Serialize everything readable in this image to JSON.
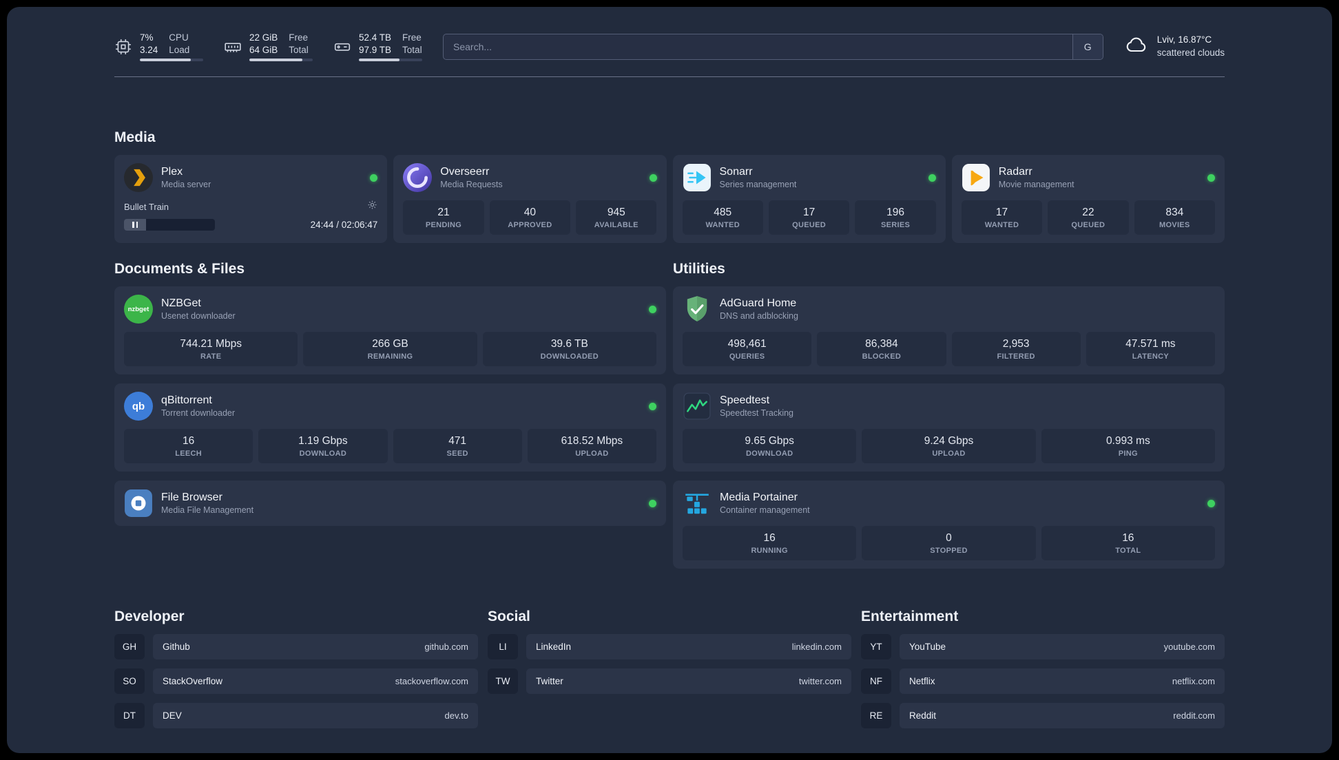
{
  "topbar": {
    "cpu": {
      "icon": "cpu-chip-icon",
      "percent": "7%",
      "load": "3.24",
      "label_top": "CPU",
      "label_bottom": "Load",
      "bar_percent": 80
    },
    "ram": {
      "icon": "ram-icon",
      "free": "22 GiB",
      "total": "64 GiB",
      "label_top": "Free",
      "label_bottom": "Total",
      "bar_percent": 84
    },
    "disk": {
      "icon": "hard-disk-icon",
      "free": "52.4 TB",
      "total": "97.9 TB",
      "label_top": "Free",
      "label_bottom": "Total",
      "bar_percent": 64
    },
    "search": {
      "placeholder": "Search...",
      "engine_button": "G"
    },
    "weather": {
      "icon": "cloud-icon",
      "location": "Lviv, 16.87°C",
      "condition": "scattered clouds"
    }
  },
  "icons": {
    "nzbget_label": "nzbget",
    "qbittorrent_label": "qb"
  },
  "sections": {
    "media": {
      "heading": "Media",
      "plex": {
        "icon": "plex-icon",
        "title": "Plex",
        "subtitle": "Media server",
        "now_playing": "Bullet Train",
        "time": "24:44 / 02:06:47"
      },
      "overseerr": {
        "icon": "overseerr-icon",
        "title": "Overseerr",
        "subtitle": "Media Requests",
        "stats": [
          {
            "value": "21",
            "label": "PENDING"
          },
          {
            "value": "40",
            "label": "APPROVED"
          },
          {
            "value": "945",
            "label": "AVAILABLE"
          }
        ]
      },
      "sonarr": {
        "icon": "sonarr-icon",
        "title": "Sonarr",
        "subtitle": "Series management",
        "stats": [
          {
            "value": "485",
            "label": "WANTED"
          },
          {
            "value": "17",
            "label": "QUEUED"
          },
          {
            "value": "196",
            "label": "SERIES"
          }
        ]
      },
      "radarr": {
        "icon": "radarr-icon",
        "title": "Radarr",
        "subtitle": "Movie management",
        "stats": [
          {
            "value": "17",
            "label": "WANTED"
          },
          {
            "value": "22",
            "label": "QUEUED"
          },
          {
            "value": "834",
            "label": "MOVIES"
          }
        ]
      }
    },
    "documents": {
      "heading": "Documents & Files",
      "nzbget": {
        "icon": "nzbget-icon",
        "title": "NZBGet",
        "subtitle": "Usenet downloader",
        "stats": [
          {
            "value": "744.21 Mbps",
            "label": "RATE"
          },
          {
            "value": "266 GB",
            "label": "REMAINING"
          },
          {
            "value": "39.6 TB",
            "label": "DOWNLOADED"
          }
        ]
      },
      "qbittorrent": {
        "icon": "qbittorrent-icon",
        "title": "qBittorrent",
        "subtitle": "Torrent downloader",
        "stats": [
          {
            "value": "16",
            "label": "LEECH"
          },
          {
            "value": "1.19 Gbps",
            "label": "DOWNLOAD"
          },
          {
            "value": "471",
            "label": "SEED"
          },
          {
            "value": "618.52 Mbps",
            "label": "UPLOAD"
          }
        ]
      },
      "filebrowser": {
        "icon": "filebrowser-icon",
        "title": "File Browser",
        "subtitle": "Media File Management"
      }
    },
    "utilities": {
      "heading": "Utilities",
      "adguard": {
        "icon": "adguard-shield-icon",
        "title": "AdGuard Home",
        "subtitle": "DNS and adblocking",
        "stats": [
          {
            "value": "498,461",
            "label": "QUERIES"
          },
          {
            "value": "86,384",
            "label": "BLOCKED"
          },
          {
            "value": "2,953",
            "label": "FILTERED"
          },
          {
            "value": "47.571 ms",
            "label": "LATENCY"
          }
        ]
      },
      "speedtest": {
        "icon": "speedtest-graph-icon",
        "title": "Speedtest",
        "subtitle": "Speedtest Tracking",
        "stats": [
          {
            "value": "9.65 Gbps",
            "label": "DOWNLOAD"
          },
          {
            "value": "9.24 Gbps",
            "label": "UPLOAD"
          },
          {
            "value": "0.993 ms",
            "label": "PING"
          }
        ]
      },
      "portainer": {
        "icon": "portainer-crane-icon",
        "title": "Media Portainer",
        "subtitle": "Container management",
        "stats": [
          {
            "value": "16",
            "label": "RUNNING"
          },
          {
            "value": "0",
            "label": "STOPPED"
          },
          {
            "value": "16",
            "label": "TOTAL"
          }
        ]
      }
    },
    "bookmarks": {
      "developer": {
        "heading": "Developer",
        "items": [
          {
            "abbr": "GH",
            "name": "Github",
            "url": "github.com"
          },
          {
            "abbr": "SO",
            "name": "StackOverflow",
            "url": "stackoverflow.com"
          },
          {
            "abbr": "DT",
            "name": "DEV",
            "url": "dev.to"
          }
        ]
      },
      "social": {
        "heading": "Social",
        "items": [
          {
            "abbr": "LI",
            "name": "LinkedIn",
            "url": "linkedin.com"
          },
          {
            "abbr": "TW",
            "name": "Twitter",
            "url": "twitter.com"
          }
        ]
      },
      "entertainment": {
        "heading": "Entertainment",
        "items": [
          {
            "abbr": "YT",
            "name": "YouTube",
            "url": "youtube.com"
          },
          {
            "abbr": "NF",
            "name": "Netflix",
            "url": "netflix.com"
          },
          {
            "abbr": "RE",
            "name": "Reddit",
            "url": "reddit.com"
          }
        ]
      }
    }
  },
  "colors": {
    "status_online": "#3ed160",
    "plex_amber": "#e5a00d",
    "adguard_green": "#67b279",
    "portainer_blue": "#24a7e0"
  }
}
